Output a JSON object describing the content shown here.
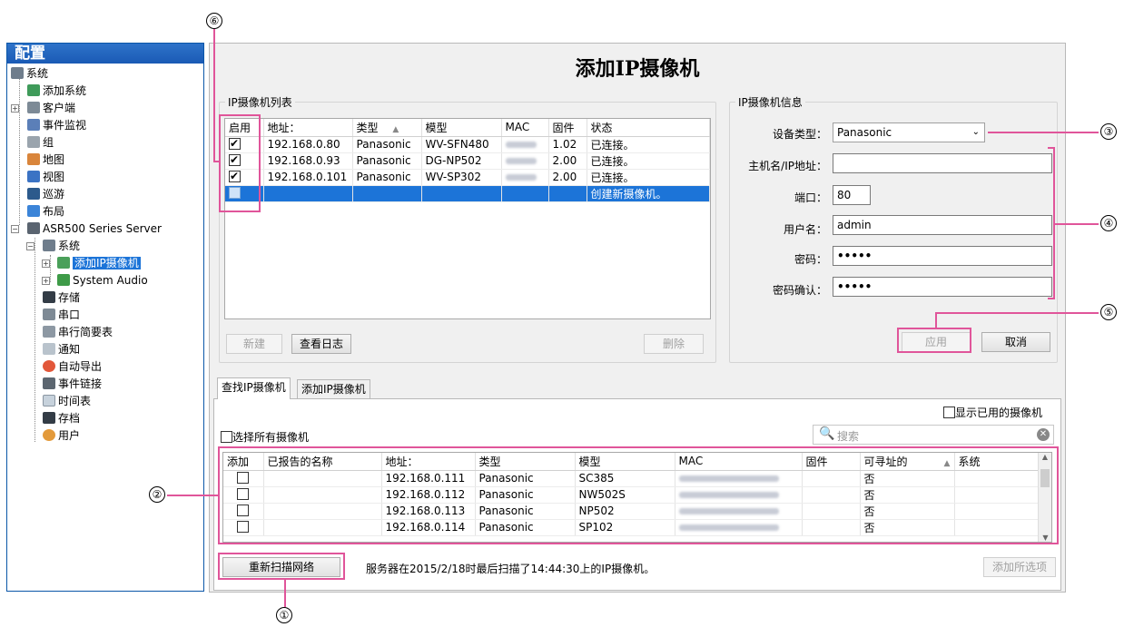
{
  "sidebar": {
    "title": "配置",
    "items": [
      {
        "label": "系统"
      },
      {
        "label": "添加系统"
      },
      {
        "label": "客户端"
      },
      {
        "label": "事件监视"
      },
      {
        "label": "组"
      },
      {
        "label": "地图"
      },
      {
        "label": "视图"
      },
      {
        "label": "巡游"
      },
      {
        "label": "布局"
      },
      {
        "label": "ASR500 Series Server"
      },
      {
        "label": "系统"
      },
      {
        "label": "添加IP摄像机"
      },
      {
        "label": "System Audio"
      },
      {
        "label": "存储"
      },
      {
        "label": "串口"
      },
      {
        "label": "串行简要表"
      },
      {
        "label": "通知"
      },
      {
        "label": "自动导出"
      },
      {
        "label": "事件链接"
      },
      {
        "label": "时间表"
      },
      {
        "label": "存档"
      },
      {
        "label": "用户"
      }
    ]
  },
  "page_title": "添加IP摄像机",
  "camera_list": {
    "legend": "IP摄像机列表",
    "columns": [
      "启用",
      "地址：",
      "类型",
      "模型",
      "MAC",
      "固件",
      "状态"
    ],
    "sort_indicator": "▲",
    "rows": [
      {
        "address": "192.168.0.80",
        "type": "Panasonic",
        "model": "WV-SFN480",
        "firmware": "1.02",
        "status": "已连接。"
      },
      {
        "address": "192.168.0.93",
        "type": "Panasonic",
        "model": "DG-NP502",
        "firmware": "2.00",
        "status": "已连接。"
      },
      {
        "address": "192.168.0.101",
        "type": "Panasonic",
        "model": "WV-SP302",
        "firmware": "2.00",
        "status": "已连接。"
      }
    ],
    "new_row_status": "创建新摄像机。",
    "new_button": "新建",
    "log_button": "查看日志",
    "delete_button": "删除"
  },
  "camera_info": {
    "legend": "IP摄像机信息",
    "device_type_label": "设备类型：",
    "device_type_value": "Panasonic",
    "host_label": "主机名/IP地址：",
    "host_value": "",
    "port_label": "端口：",
    "port_value": "80",
    "username_label": "用户名：",
    "username_value": "admin",
    "password_label": "密码：",
    "password_value": "•••••",
    "password_confirm_label": "密码确认：",
    "password_confirm_value": "•••••",
    "apply_button": "应用",
    "cancel_button": "取消"
  },
  "tabs": {
    "find": "查找IP摄像机",
    "add": "添加IP摄像机"
  },
  "find": {
    "show_used_label": "显示已用的摄像机",
    "select_all_label": "选择所有摄像机",
    "search_placeholder": "搜索",
    "columns": [
      "添加",
      "已报告的名称",
      "地址：",
      "类型",
      "模型",
      "MAC",
      "固件",
      "可寻址的",
      "系统"
    ],
    "sort_indicator": "▲",
    "rows": [
      {
        "address": "192.168.0.111",
        "type": "Panasonic",
        "model": "SC385",
        "addressable": "否"
      },
      {
        "address": "192.168.0.112",
        "type": "Panasonic",
        "model": "NW502S",
        "addressable": "否"
      },
      {
        "address": "192.168.0.113",
        "type": "Panasonic",
        "model": "NP502",
        "addressable": "否"
      },
      {
        "address": "192.168.0.114",
        "type": "Panasonic",
        "model": "SP102",
        "addressable": "否"
      }
    ],
    "rescan_button": "重新扫描网络",
    "scan_status": "服务器在2015/2/18时最后扫描了14:44:30上的IP摄像机。",
    "add_selected_button": "添加所选项"
  },
  "callouts": [
    "①",
    "②",
    "③",
    "④",
    "⑤",
    "⑥"
  ],
  "colors": {
    "accent": "#e0559a",
    "selection": "#1c74d8",
    "header": "#1a5ab5"
  }
}
